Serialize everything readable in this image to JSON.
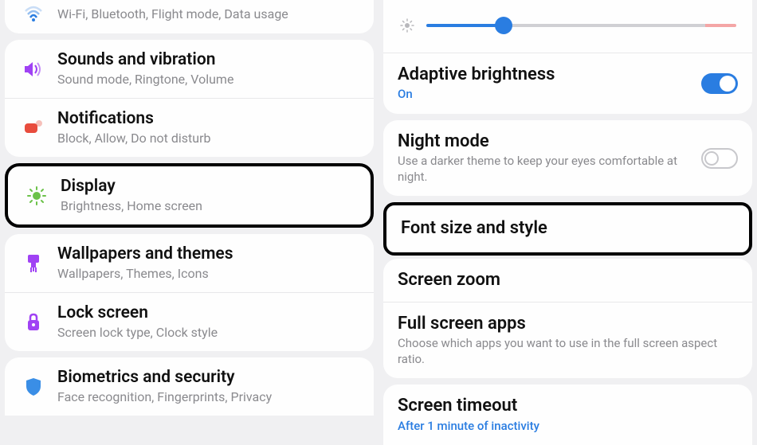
{
  "left": {
    "connections": {
      "subtitle": "Wi-Fi, Bluetooth, Flight mode, Data usage"
    },
    "sounds": {
      "title": "Sounds and vibration",
      "subtitle": "Sound mode, Ringtone, Volume"
    },
    "notifications": {
      "title": "Notifications",
      "subtitle": "Block, Allow, Do not disturb"
    },
    "display": {
      "title": "Display",
      "subtitle": "Brightness, Home screen"
    },
    "wallpapers": {
      "title": "Wallpapers and themes",
      "subtitle": "Wallpapers, Themes, Icons"
    },
    "lockscreen": {
      "title": "Lock screen",
      "subtitle": "Screen lock type, Clock style"
    },
    "biometrics": {
      "title": "Biometrics and security",
      "subtitle": "Face recognition, Fingerprints, Privacy"
    }
  },
  "right": {
    "brightness_value": 25,
    "adaptive": {
      "title": "Adaptive brightness",
      "status": "On",
      "on": true
    },
    "night": {
      "title": "Night mode",
      "subtitle": "Use a darker theme to keep your eyes comfortable at night.",
      "on": false
    },
    "font": {
      "title": "Font size and style"
    },
    "zoom": {
      "title": "Screen zoom"
    },
    "fullscreen": {
      "title": "Full screen apps",
      "subtitle": "Choose which apps you want to use in the full screen aspect ratio."
    },
    "timeout": {
      "title": "Screen timeout",
      "subtitle": "After 1 minute of inactivity"
    }
  }
}
